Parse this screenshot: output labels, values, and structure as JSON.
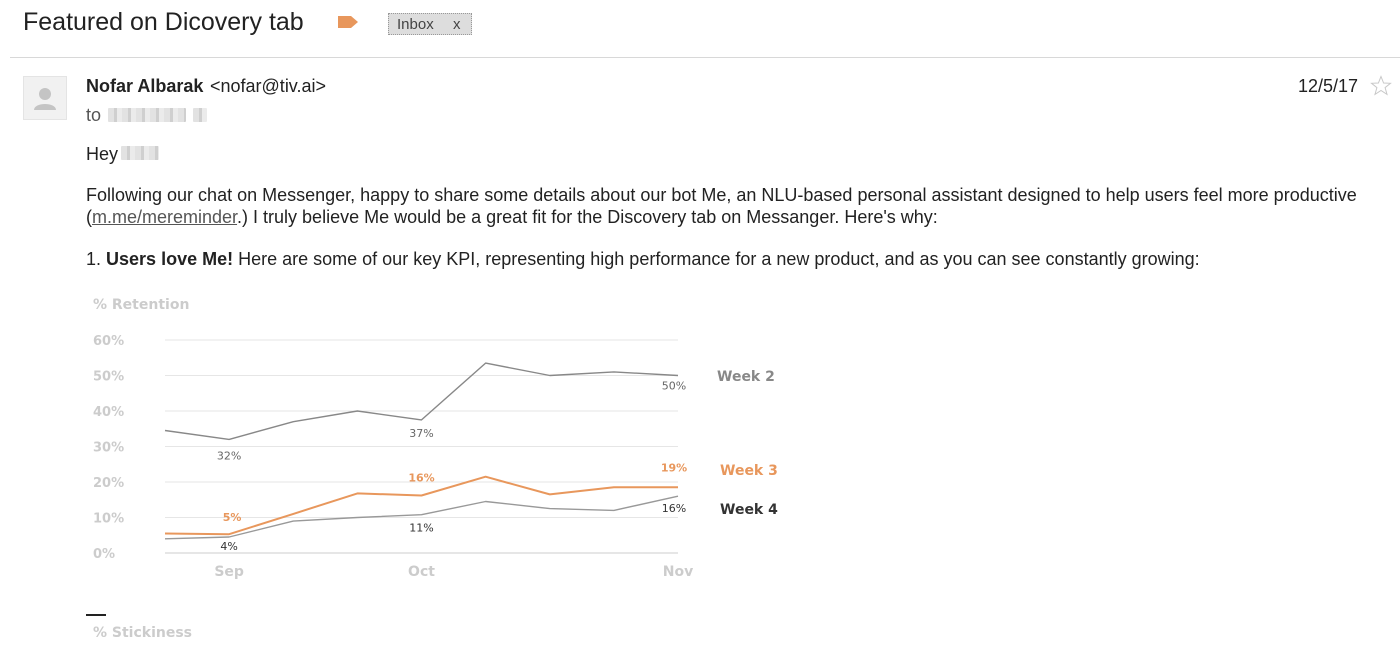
{
  "email": {
    "subject": "Featured on Dicovery tab",
    "label_chip": {
      "text": "Inbox",
      "close": "x"
    },
    "sender": {
      "name": "Nofar Albarak",
      "email": "<nofar@tiv.ai>"
    },
    "to_label": "to",
    "date": "12/5/17",
    "greeting": "Hey",
    "paragraph1": {
      "line1": "Following our chat on Messenger, happy to share some details about our bot Me, an NLU-based personal assistant designed to help users feel more productive",
      "line2_open": "(",
      "link": "m.me/mereminder",
      "line2_rest": ".) I truly believe Me would be a great fit for the Discovery tab on Messanger. Here's why:"
    },
    "point1": {
      "number": "1.",
      "bold": "Users love Me!",
      "rest": "Here are some of our key KPI, representing high performance for a new product, and as you can see constantly growing:"
    }
  },
  "icons": {
    "label": "label-tag-icon",
    "avatar": "person-icon",
    "star": "star-outline-icon"
  },
  "colors": {
    "week2": "#888888",
    "week3": "#e8975c",
    "week4": "#999999",
    "grid": "#e6e6e6",
    "axis": "#cccccc"
  },
  "chart_data": {
    "type": "line",
    "title": "% Retention",
    "ylim": [
      0,
      60
    ],
    "yticks": [
      "0%",
      "10%",
      "20%",
      "30%",
      "40%",
      "50%",
      "60%"
    ],
    "xticks": [
      "Sep",
      "Oct",
      "Nov"
    ],
    "x": [
      0,
      1,
      2,
      3,
      4,
      5,
      6,
      7,
      8
    ],
    "series": [
      {
        "name": "Week 2",
        "values": [
          34.5,
          32,
          37,
          40,
          37.5,
          53.5,
          50,
          51,
          50
        ],
        "labels": [
          {
            "i": 1,
            "text": "32%"
          },
          {
            "i": 4,
            "text": "37%"
          },
          {
            "i": 8,
            "text": "50%"
          }
        ]
      },
      {
        "name": "Week 3",
        "values": [
          5.5,
          5.3,
          11,
          16.8,
          16.2,
          21.5,
          16.5,
          18.5,
          18.5
        ],
        "labels": [
          {
            "i": 1,
            "text": "5%"
          },
          {
            "i": 4,
            "text": "16%"
          },
          {
            "i": 8,
            "text": "19%"
          }
        ]
      },
      {
        "name": "Week 4",
        "values": [
          4,
          4.5,
          9,
          10,
          10.8,
          14.5,
          12.5,
          12,
          16
        ],
        "labels": [
          {
            "i": 1,
            "text": "4%"
          },
          {
            "i": 4,
            "text": "11%"
          },
          {
            "i": 8,
            "text": "16%"
          }
        ]
      }
    ],
    "grid": true,
    "legend": "right",
    "next_title": "% Stickiness"
  }
}
